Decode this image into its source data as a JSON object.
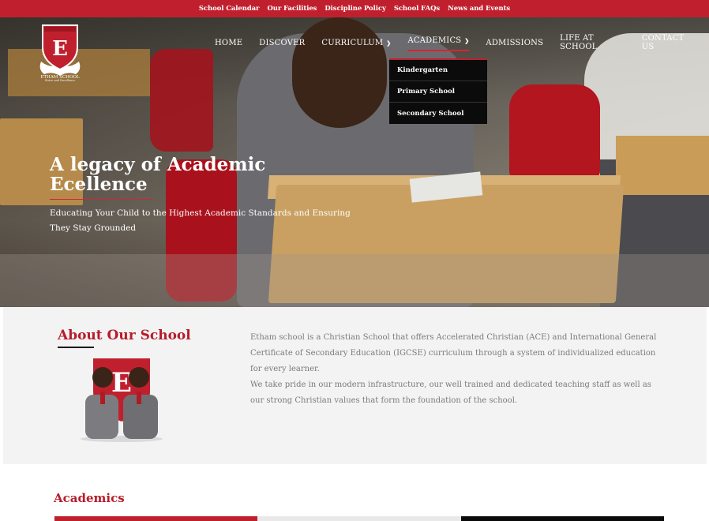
{
  "topbar": {
    "links": [
      "School Calendar",
      "Our Facilities",
      "Discipline Policy",
      "School FAQs",
      "News and Events"
    ]
  },
  "logo": {
    "letter": "E",
    "name": "ETHAM SCHOOL",
    "tagline": "Strive and Excellence"
  },
  "nav": {
    "items": [
      {
        "label": "HOME"
      },
      {
        "label": "DISCOVER"
      },
      {
        "label": "CURRICULUM",
        "chevron": "chevron-down-icon"
      },
      {
        "label": "ACADEMICS",
        "chevron": "chevron-down-icon",
        "active": true
      },
      {
        "label": "ADMISSIONS"
      },
      {
        "label": "LIFE AT SCHOOL"
      },
      {
        "label": "CONTACT US"
      }
    ]
  },
  "dropdown": {
    "items": [
      "Kindergarten",
      "Primary School",
      "Secondary School"
    ]
  },
  "hero": {
    "title_line1": "A legacy of Academic",
    "title_line2": "Ecellence",
    "subtitle": "Educating Your Child to the Highest Academic Standards and Ensuring They Stay Grounded"
  },
  "about": {
    "title": "About Our School",
    "paragraph1": "Etham school is a Christian School that offers Accelerated Christian (ACE) and International General Certificate of Secondary Education (IGCSE) curriculum through a system of individualized education for every learner.",
    "paragraph2": "We take pride in our modern infrastructure, our well trained and dedicated teaching staff as well as our strong Christian values that form the foundation of the school."
  },
  "academics": {
    "title": "Academics"
  },
  "colors": {
    "brand_red": "#c0202e",
    "heading_red": "#b81c2a",
    "dropdown_bg": "#0b0b0b",
    "about_bg": "#f3f3f3"
  }
}
